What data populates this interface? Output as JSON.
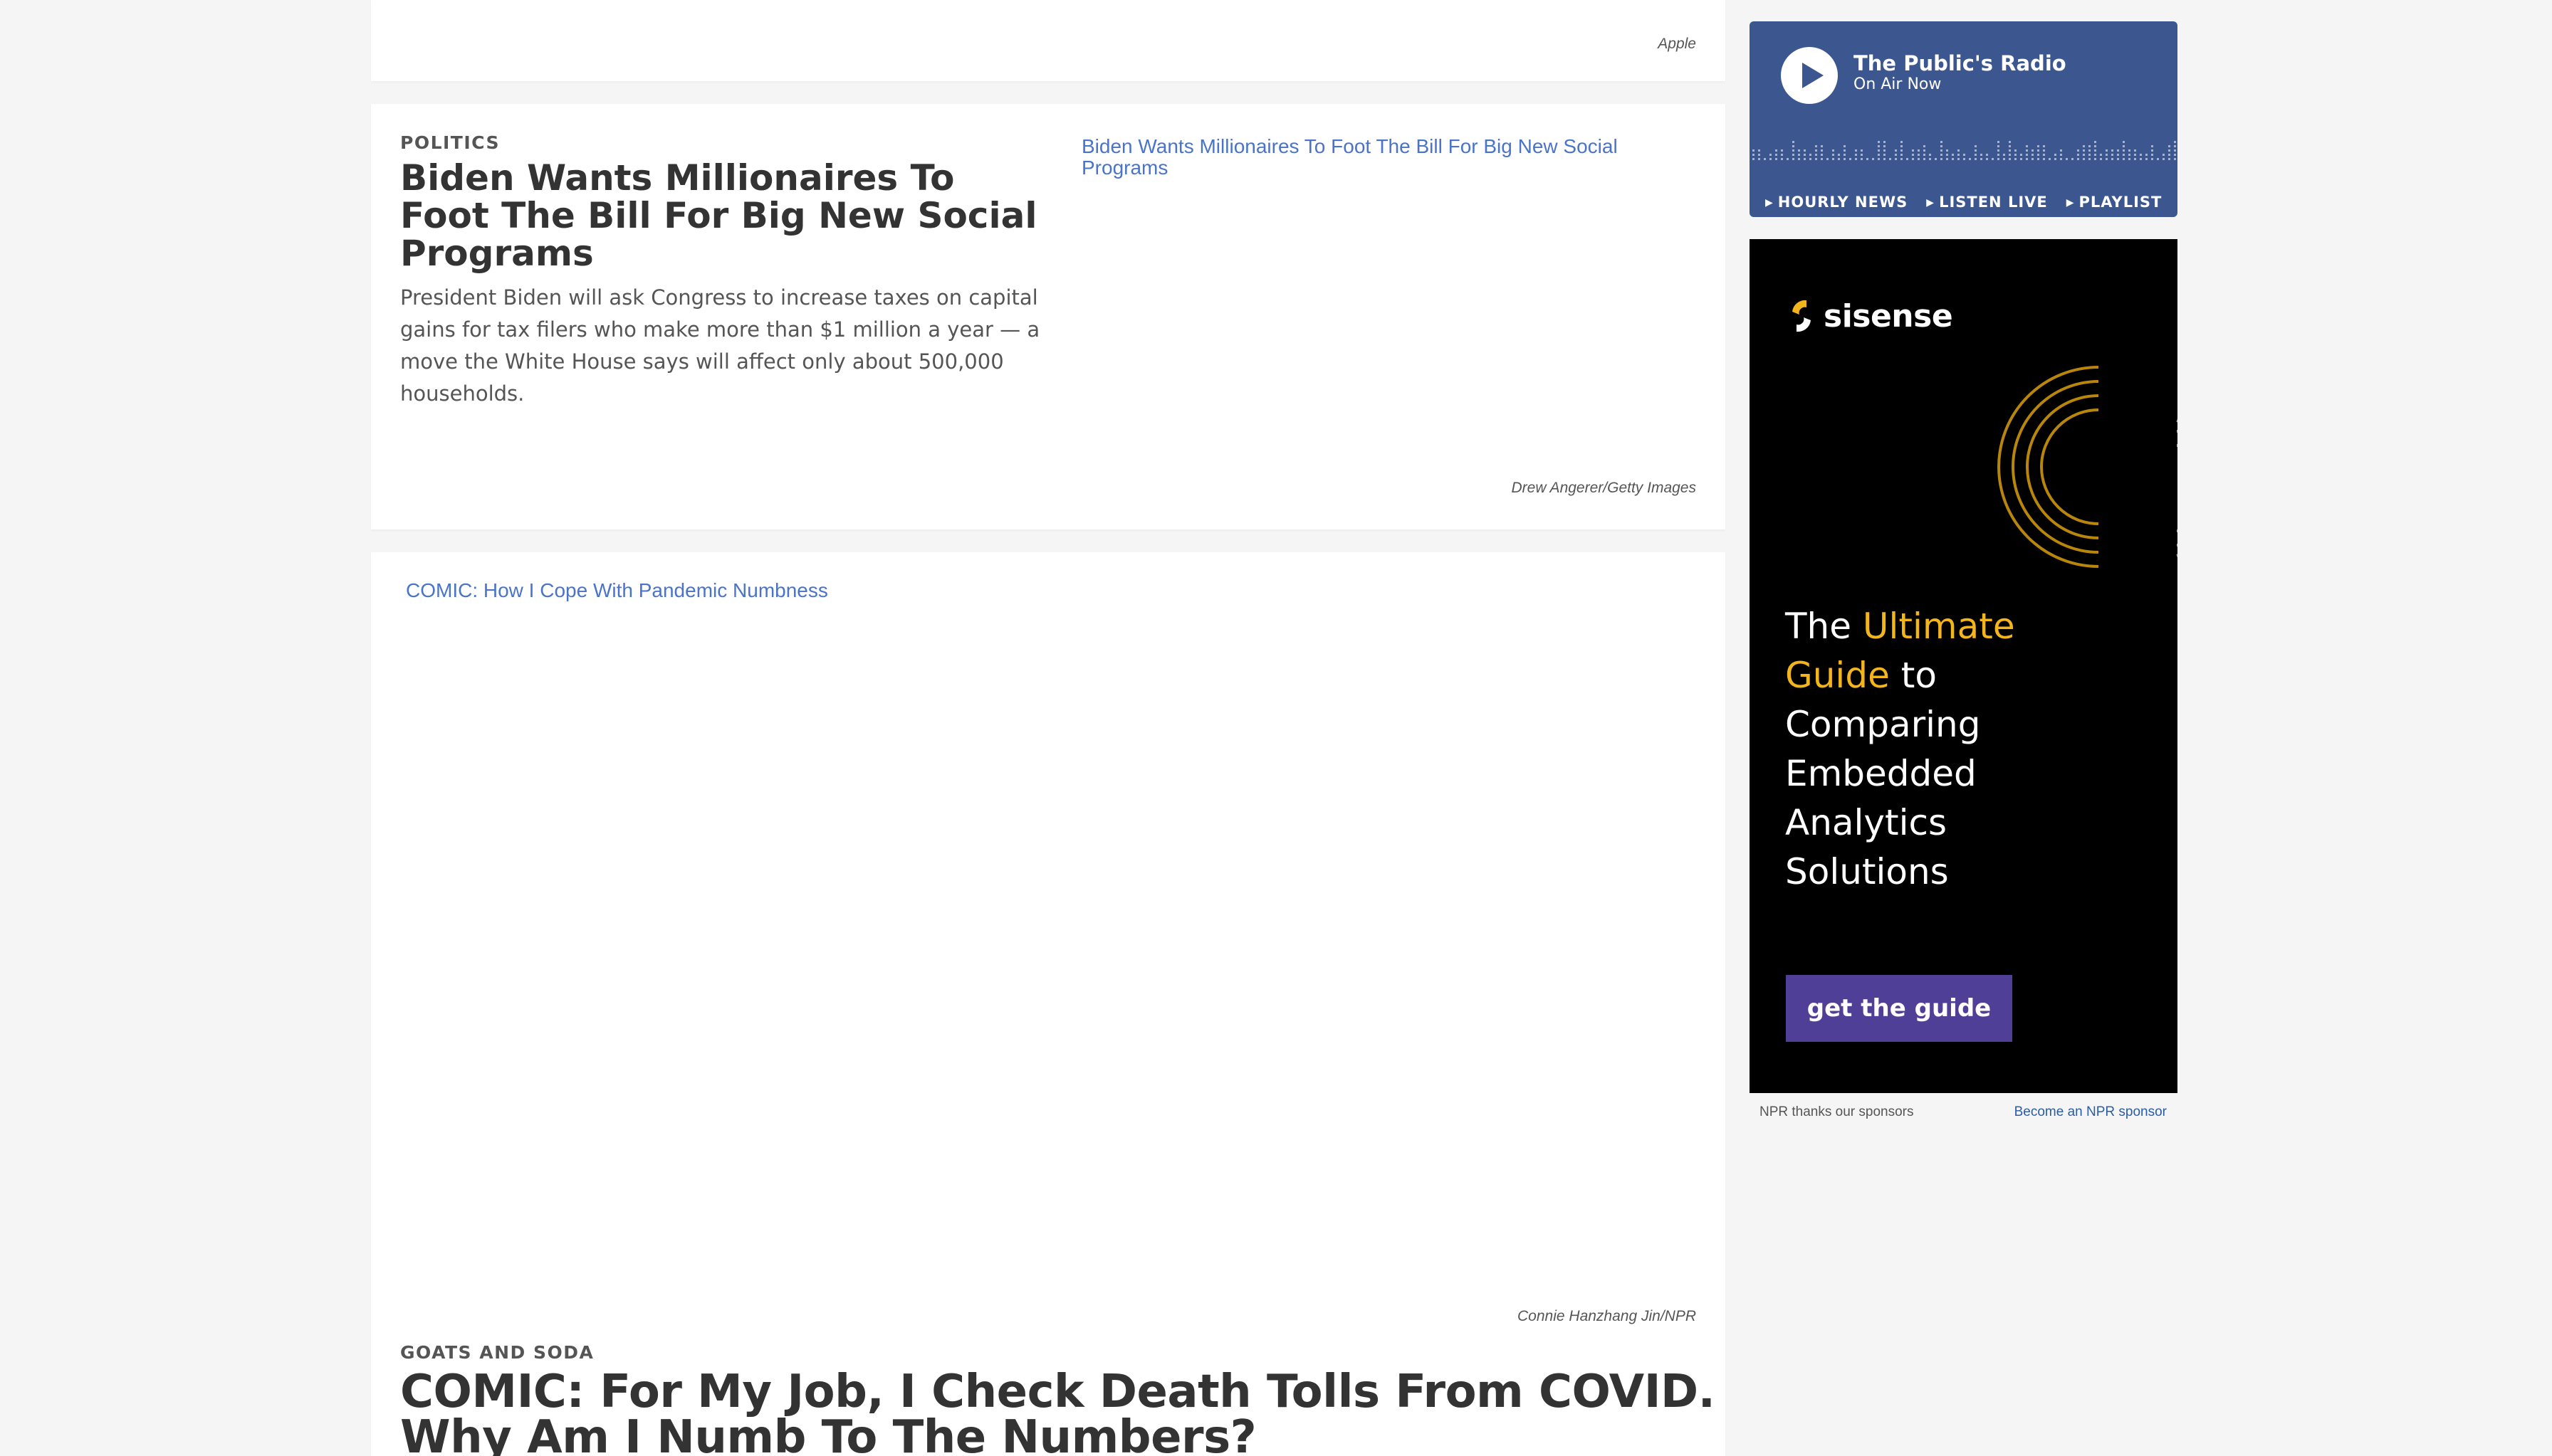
{
  "stories": {
    "top_card": {
      "credit": "Apple"
    },
    "politics": {
      "slug": "POLITICS",
      "headline": "Biden Wants Millionaires To Foot The Bill For Big New Social Programs",
      "teaser": "President Biden will ask Congress to increase taxes on capital gains for tax filers who make more than $1 million a year — a move the White House says will affect only about 500,000 households.",
      "image_alt": "Biden Wants Millionaires To Foot The Bill For Big New Social Programs",
      "credit": "Drew Angerer/Getty Images"
    },
    "goats": {
      "image_alt": "COMIC: How I Cope With Pandemic Numbness",
      "credit": "Connie Hanzhang Jin/NPR",
      "slug": "GOATS AND SODA",
      "headline": "COMIC: For My Job, I Check Death Tolls From COVID. Why Am I Numb To The Numbers?"
    }
  },
  "radio": {
    "station": "The Public's Radio",
    "status": "On Air Now",
    "links": [
      "HOURLY NEWS",
      "LISTEN LIVE",
      "PLAYLIST"
    ],
    "accent": "#3c5690"
  },
  "ad": {
    "brand": "sisense",
    "copy_pre": "The ",
    "copy_highlight": "Ultimate Guide",
    "copy_post": " to Comparing Embedded Analytics Solutions",
    "button": "get the guide",
    "highlight_color": "#f3b51c",
    "button_color": "#4f3f96"
  },
  "sponsor": {
    "thanks": "NPR thanks our sponsors",
    "link": "Become an NPR sponsor"
  }
}
